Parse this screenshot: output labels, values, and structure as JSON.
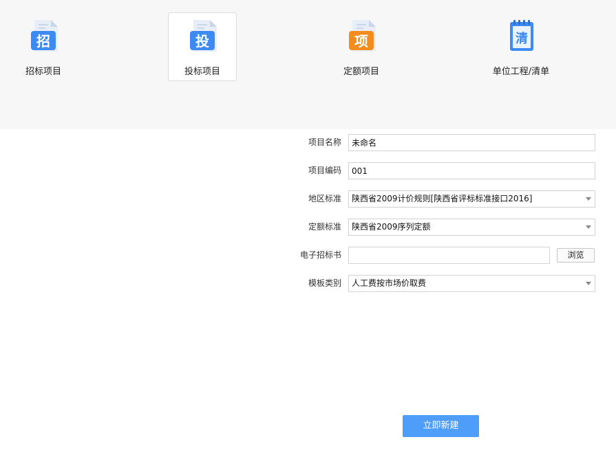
{
  "project_types": [
    {
      "label": "招标项目",
      "glyph": "招",
      "color": "#3d8bf2",
      "icon": "tender-document-icon",
      "selected": false
    },
    {
      "label": "投标项目",
      "glyph": "投",
      "color": "#3d8bf2",
      "icon": "bid-document-icon",
      "selected": true
    },
    {
      "label": "定额项目",
      "glyph": "项",
      "color": "#f28c1f",
      "icon": "quota-document-icon",
      "selected": false
    },
    {
      "label": "单位工程/清单",
      "glyph": "清",
      "color": "#3d8bf2",
      "icon": "bill-notebook-icon",
      "selected": false
    }
  ],
  "form": {
    "project_name": {
      "label": "项目名称",
      "value": "未命名"
    },
    "project_code": {
      "label": "项目编码",
      "value": "001"
    },
    "region_standard": {
      "label": "地区标准",
      "value": "陕西省2009计价规则[陕西省评标标准接口2016]"
    },
    "quota_standard": {
      "label": "定额标准",
      "value": "陕西省2009序列定额"
    },
    "tender_file": {
      "label": "电子招标书",
      "value": "",
      "browse_label": "浏览"
    },
    "template_type": {
      "label": "模板类别",
      "value": "人工费按市场价取费"
    }
  },
  "actions": {
    "create_label": "立即新建"
  },
  "colors": {
    "primary_button": "#4e9df8",
    "blue_icon": "#3d8bf2",
    "orange_icon": "#f28c1f",
    "top_background": "#f7f7f7"
  }
}
